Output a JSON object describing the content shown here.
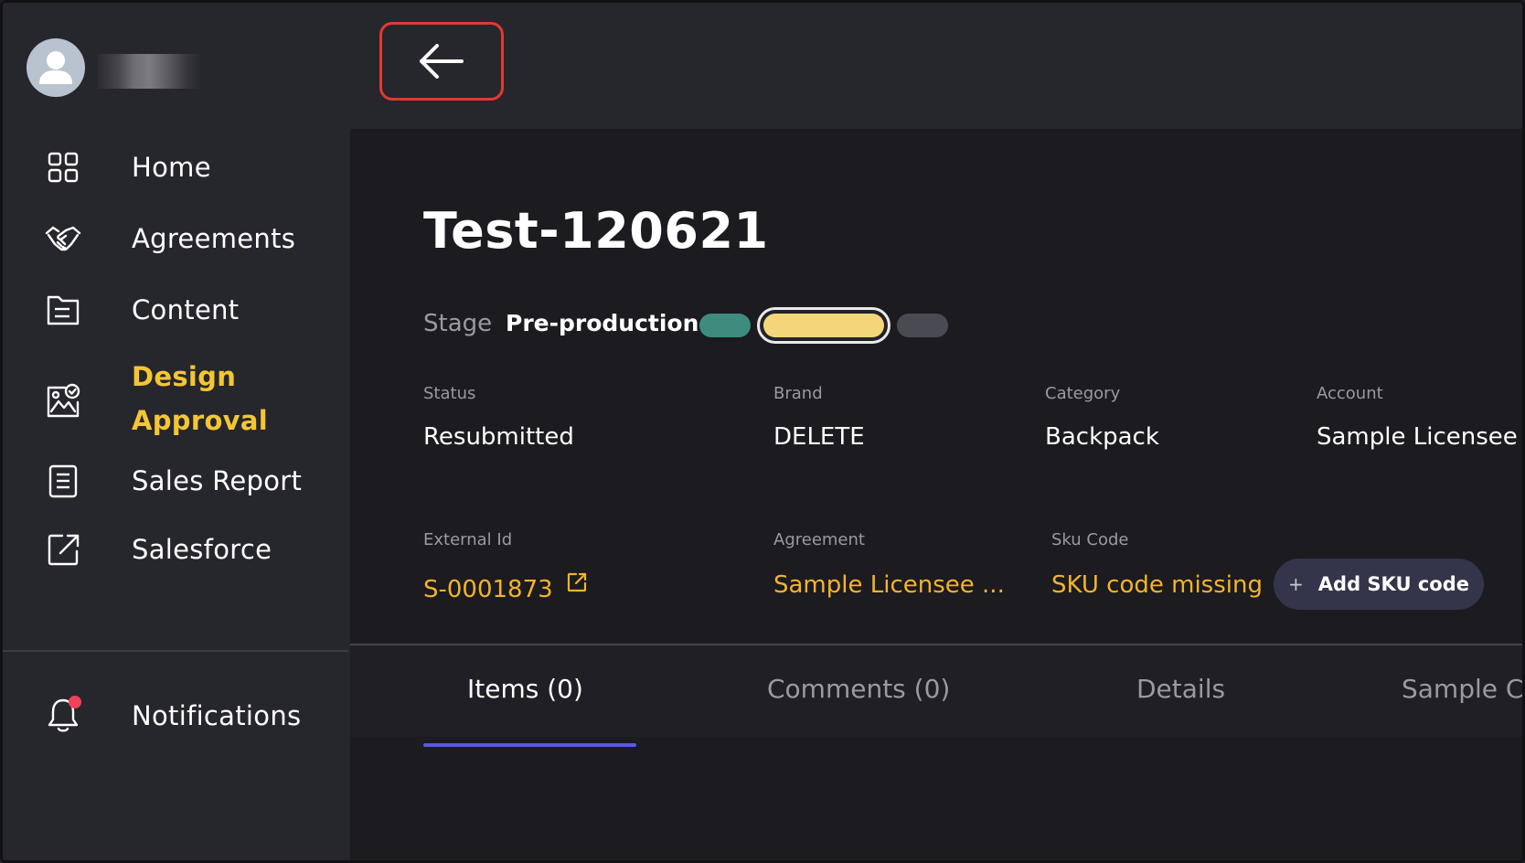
{
  "user": {
    "name": ""
  },
  "header": {
    "back_icon": "arrow-left-icon"
  },
  "sidebar": {
    "items": [
      {
        "label": "Home",
        "icon": "grid-icon"
      },
      {
        "label": "Agreements",
        "icon": "handshake-icon"
      },
      {
        "label": "Content",
        "icon": "document-icon"
      },
      {
        "label": "Design Approval",
        "icon": "image-check-icon",
        "active": true
      },
      {
        "label": "Sales Report",
        "icon": "report-icon"
      },
      {
        "label": "Salesforce",
        "icon": "external-link-icon"
      }
    ],
    "notifications": {
      "label": "Notifications",
      "icon": "bell-icon",
      "has_unread": true
    }
  },
  "page": {
    "title": "Test-120621",
    "stage": {
      "label": "Stage",
      "value": "Pre-production",
      "steps": [
        "done",
        "current",
        "pending"
      ]
    },
    "fields": {
      "status": {
        "label": "Status",
        "value": "Resubmitted"
      },
      "brand": {
        "label": "Brand",
        "value": "DELETE"
      },
      "category": {
        "label": "Category",
        "value": "Backpack"
      },
      "account": {
        "label": "Account",
        "value": "Sample Licensee A"
      },
      "external_id": {
        "label": "External Id",
        "value": "S-0001873"
      },
      "agreement": {
        "label": "Agreement",
        "value": "Sample Licensee ..."
      },
      "sku_code": {
        "label": "Sku Code",
        "value": "SKU code missing"
      }
    },
    "add_sku_label": "Add SKU code"
  },
  "tabs": [
    {
      "label": "Items (0)",
      "active": true
    },
    {
      "label": "Comments (0)",
      "active": false
    },
    {
      "label": "Details",
      "active": false
    },
    {
      "label": "Sample C",
      "active": false
    }
  ],
  "colors": {
    "accent_yellow": "#f3c634",
    "link_orange": "#f3b42b",
    "tab_underline": "#5b57e6",
    "stage_done": "#3e8c7e",
    "stage_current": "#f4d67a",
    "back_button_border": "#e5392f",
    "notification_dot": "#f0435a"
  }
}
